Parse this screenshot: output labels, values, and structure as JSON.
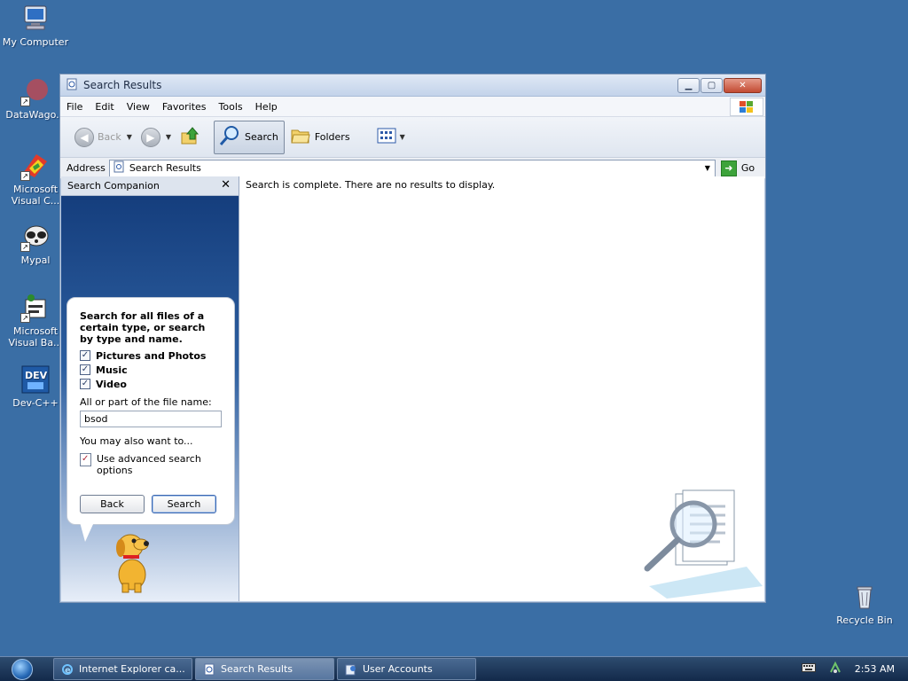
{
  "desktop": {
    "icons": [
      {
        "label": "My Computer"
      },
      {
        "label": "DataWago..."
      },
      {
        "label": "Microsoft Visual C..."
      },
      {
        "label": "Mypal"
      },
      {
        "label": "Microsoft Visual Ba..."
      },
      {
        "label": "Dev-C++"
      },
      {
        "label": "Recycle Bin"
      }
    ]
  },
  "window": {
    "title": "Search Results",
    "menu": [
      "File",
      "Edit",
      "View",
      "Favorites",
      "Tools",
      "Help"
    ],
    "toolbar": {
      "back": "Back",
      "search": "Search",
      "folders": "Folders"
    },
    "address": {
      "label": "Address",
      "value": "Search Results",
      "go": "Go"
    },
    "companion": {
      "title": "Search Companion",
      "intro": "Search for all files of a certain type, or search by type and name.",
      "options": [
        {
          "label": "Pictures and Photos",
          "checked": true
        },
        {
          "label": "Music",
          "checked": true
        },
        {
          "label": "Video",
          "checked": true
        }
      ],
      "filename_label": "All or part of the file name:",
      "filename_value": "bsod",
      "also": "You may also want to...",
      "advanced": "Use advanced search options",
      "back_button": "Back",
      "search_button": "Search"
    },
    "results": {
      "message": "Search is complete. There are no results to display."
    }
  },
  "taskbar": {
    "tasks": [
      {
        "label": "Internet Explorer ca...",
        "active": false
      },
      {
        "label": "Search Results",
        "active": true
      },
      {
        "label": "User Accounts",
        "active": false
      }
    ],
    "clock": "2:53 AM"
  }
}
